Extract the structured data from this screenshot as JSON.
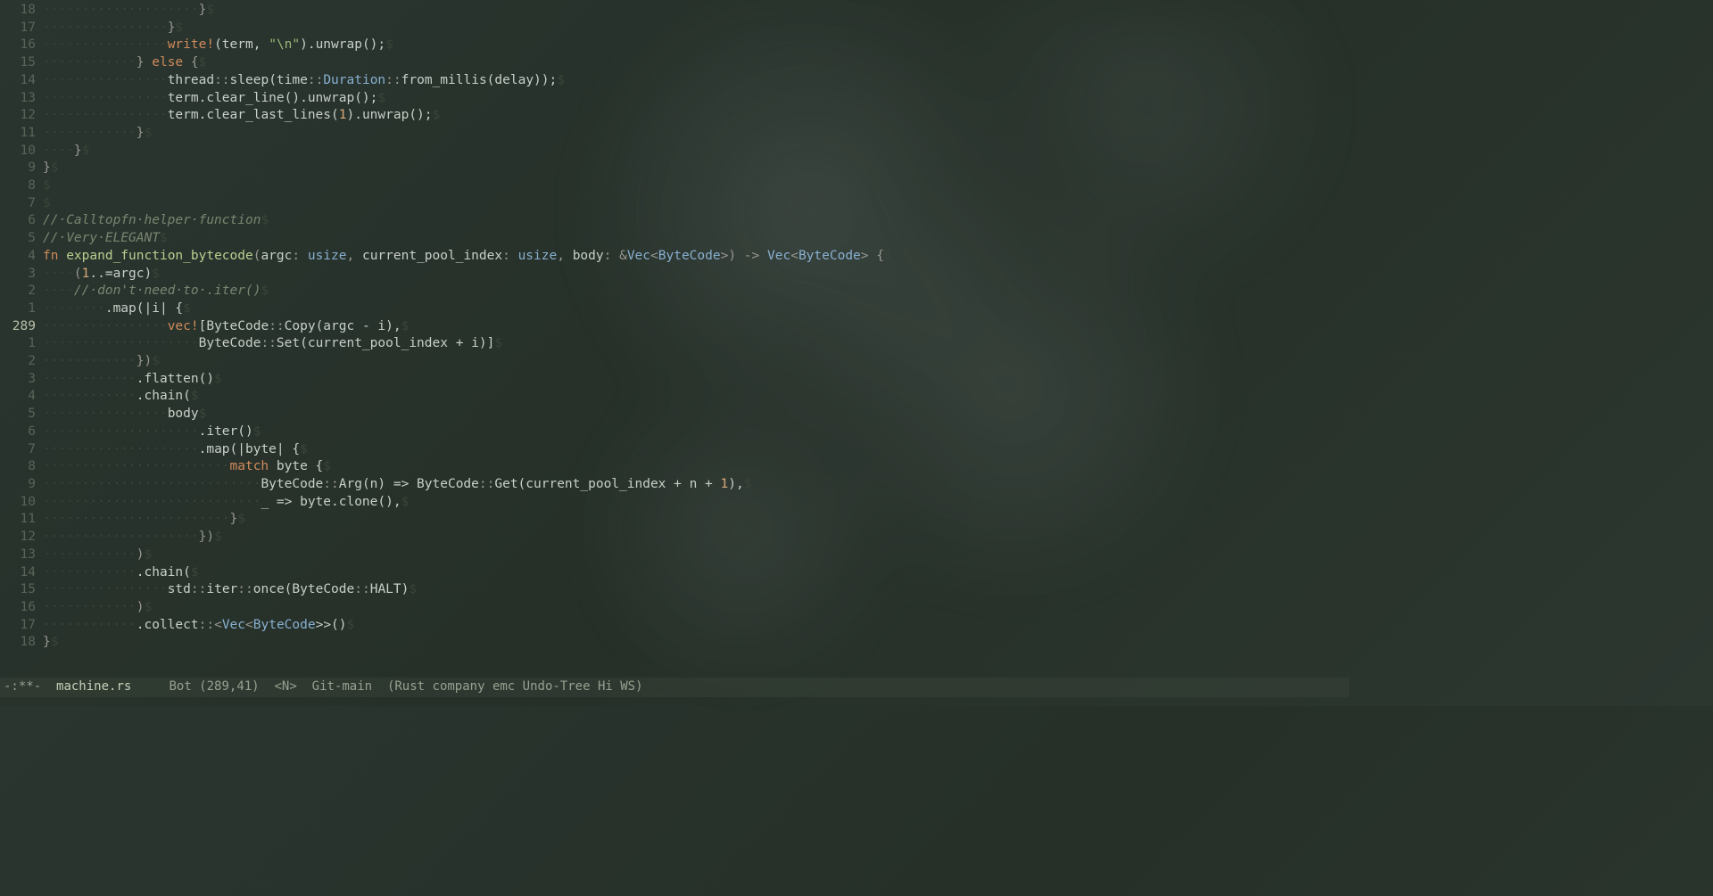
{
  "modeline": {
    "modified": "-:**-",
    "filename": "machine.rs",
    "position": "Bot (289,41)",
    "mode_indicator": "<N>",
    "vc": "Git-main",
    "modes": "(Rust company emc Undo-Tree Hi WS)"
  },
  "current_line": "289",
  "lines": [
    {
      "n": "18",
      "indent": 20,
      "tokens": [
        {
          "t": "}",
          "c": "punct"
        }
      ]
    },
    {
      "n": "17",
      "indent": 16,
      "tokens": [
        {
          "t": "}",
          "c": "punct"
        }
      ]
    },
    {
      "n": "16",
      "indent": 16,
      "tokens": [
        {
          "t": "write!",
          "c": "macro"
        },
        {
          "t": "(term, ",
          "c": "var"
        },
        {
          "t": "\"\\n\"",
          "c": "str"
        },
        {
          "t": ").unwrap();",
          "c": "var"
        }
      ]
    },
    {
      "n": "15",
      "indent": 12,
      "tokens": [
        {
          "t": "} ",
          "c": "punct"
        },
        {
          "t": "else",
          "c": "kw"
        },
        {
          "t": " {",
          "c": "punct"
        }
      ]
    },
    {
      "n": "14",
      "indent": 16,
      "tokens": [
        {
          "t": "thread",
          "c": "var"
        },
        {
          "t": "::",
          "c": "punct"
        },
        {
          "t": "sleep(time",
          "c": "var"
        },
        {
          "t": "::",
          "c": "punct"
        },
        {
          "t": "Duration",
          "c": "type"
        },
        {
          "t": "::",
          "c": "punct"
        },
        {
          "t": "from_millis(delay));",
          "c": "var"
        }
      ]
    },
    {
      "n": "13",
      "indent": 16,
      "tokens": [
        {
          "t": "term.clear_line().unwrap();",
          "c": "var"
        }
      ]
    },
    {
      "n": "12",
      "indent": 16,
      "tokens": [
        {
          "t": "term.clear_last_lines(",
          "c": "var"
        },
        {
          "t": "1",
          "c": "num"
        },
        {
          "t": ").unwrap();",
          "c": "var"
        }
      ]
    },
    {
      "n": "11",
      "indent": 12,
      "tokens": [
        {
          "t": "}",
          "c": "punct"
        }
      ]
    },
    {
      "n": "10",
      "indent": 4,
      "tokens": [
        {
          "t": "}",
          "c": "punct"
        }
      ]
    },
    {
      "n": "9",
      "indent": 0,
      "tokens": [
        {
          "t": "}",
          "c": "punct"
        }
      ]
    },
    {
      "n": "8",
      "indent": 0,
      "tokens": [
        {
          "t": "",
          "c": "var"
        }
      ]
    },
    {
      "n": "7",
      "indent": 0,
      "tokens": [
        {
          "t": "",
          "c": "var"
        }
      ]
    },
    {
      "n": "6",
      "indent": 0,
      "tokens": [
        {
          "t": "// Calltopfn helper function",
          "c": "comment"
        }
      ]
    },
    {
      "n": "5",
      "indent": 0,
      "tokens": [
        {
          "t": "// Very ELEGANT",
          "c": "comment"
        }
      ]
    },
    {
      "n": "4",
      "indent": 0,
      "tokens": [
        {
          "t": "fn ",
          "c": "kw"
        },
        {
          "t": "expand_function_bytecode",
          "c": "fn-name"
        },
        {
          "t": "(",
          "c": "punct"
        },
        {
          "t": "argc",
          "c": "var"
        },
        {
          "t": ": ",
          "c": "punct"
        },
        {
          "t": "usize",
          "c": "type"
        },
        {
          "t": ", ",
          "c": "punct"
        },
        {
          "t": "current_pool_index",
          "c": "var"
        },
        {
          "t": ": ",
          "c": "punct"
        },
        {
          "t": "usize",
          "c": "type"
        },
        {
          "t": ", ",
          "c": "punct"
        },
        {
          "t": "body",
          "c": "var"
        },
        {
          "t": ": &",
          "c": "punct"
        },
        {
          "t": "Vec",
          "c": "type"
        },
        {
          "t": "<",
          "c": "punct"
        },
        {
          "t": "ByteCode",
          "c": "type"
        },
        {
          "t": ">) -> ",
          "c": "punct"
        },
        {
          "t": "Vec",
          "c": "type"
        },
        {
          "t": "<",
          "c": "punct"
        },
        {
          "t": "ByteCode",
          "c": "type"
        },
        {
          "t": "> {",
          "c": "punct"
        }
      ]
    },
    {
      "n": "3",
      "indent": 4,
      "tokens": [
        {
          "t": "(",
          "c": "punct"
        },
        {
          "t": "1",
          "c": "num"
        },
        {
          "t": "..=argc)",
          "c": "var"
        }
      ]
    },
    {
      "n": "2",
      "indent": 4,
      "tokens": [
        {
          "t": "// don't need to .iter()",
          "c": "comment"
        }
      ]
    },
    {
      "n": "1",
      "indent": 8,
      "tokens": [
        {
          "t": ".map(|i| {",
          "c": "var"
        }
      ]
    },
    {
      "n": "289",
      "indent": 16,
      "tokens": [
        {
          "t": "vec!",
          "c": "macro"
        },
        {
          "t": "[ByteCode",
          "c": "var"
        },
        {
          "t": "::",
          "c": "punct"
        },
        {
          "t": "Copy(argc - i),",
          "c": "var"
        }
      ]
    },
    {
      "n": "1",
      "indent": 20,
      "tokens": [
        {
          "t": "ByteCode",
          "c": "var"
        },
        {
          "t": "::",
          "c": "punct"
        },
        {
          "t": "Set(current_pool_index + i)]",
          "c": "var"
        }
      ]
    },
    {
      "n": "2",
      "indent": 12,
      "tokens": [
        {
          "t": "})",
          "c": "punct"
        }
      ]
    },
    {
      "n": "3",
      "indent": 12,
      "tokens": [
        {
          "t": ".flatten()",
          "c": "var"
        }
      ]
    },
    {
      "n": "4",
      "indent": 12,
      "tokens": [
        {
          "t": ".chain(",
          "c": "var"
        }
      ]
    },
    {
      "n": "5",
      "indent": 16,
      "tokens": [
        {
          "t": "body",
          "c": "var"
        }
      ]
    },
    {
      "n": "6",
      "indent": 20,
      "tokens": [
        {
          "t": ".iter()",
          "c": "var"
        }
      ]
    },
    {
      "n": "7",
      "indent": 20,
      "tokens": [
        {
          "t": ".map(|byte| {",
          "c": "var"
        }
      ]
    },
    {
      "n": "8",
      "indent": 24,
      "tokens": [
        {
          "t": "match ",
          "c": "kw"
        },
        {
          "t": "byte {",
          "c": "var"
        }
      ]
    },
    {
      "n": "9",
      "indent": 28,
      "tokens": [
        {
          "t": "ByteCode",
          "c": "var"
        },
        {
          "t": "::",
          "c": "punct"
        },
        {
          "t": "Arg(n) => ByteCode",
          "c": "var"
        },
        {
          "t": "::",
          "c": "punct"
        },
        {
          "t": "Get(current_pool_index + n + ",
          "c": "var"
        },
        {
          "t": "1",
          "c": "num"
        },
        {
          "t": "),",
          "c": "var"
        }
      ]
    },
    {
      "n": "10",
      "indent": 28,
      "tokens": [
        {
          "t": "_ => byte.clone(),",
          "c": "var"
        }
      ]
    },
    {
      "n": "11",
      "indent": 24,
      "tokens": [
        {
          "t": "}",
          "c": "punct"
        }
      ]
    },
    {
      "n": "12",
      "indent": 20,
      "tokens": [
        {
          "t": "})",
          "c": "punct"
        }
      ]
    },
    {
      "n": "13",
      "indent": 12,
      "tokens": [
        {
          "t": ")",
          "c": "punct"
        }
      ]
    },
    {
      "n": "14",
      "indent": 12,
      "tokens": [
        {
          "t": ".chain(",
          "c": "var"
        }
      ]
    },
    {
      "n": "15",
      "indent": 16,
      "tokens": [
        {
          "t": "std",
          "c": "var"
        },
        {
          "t": "::",
          "c": "punct"
        },
        {
          "t": "iter",
          "c": "var"
        },
        {
          "t": "::",
          "c": "punct"
        },
        {
          "t": "once(ByteCode",
          "c": "var"
        },
        {
          "t": "::",
          "c": "punct"
        },
        {
          "t": "HALT)",
          "c": "var"
        }
      ]
    },
    {
      "n": "16",
      "indent": 12,
      "tokens": [
        {
          "t": ")",
          "c": "punct"
        }
      ]
    },
    {
      "n": "17",
      "indent": 12,
      "tokens": [
        {
          "t": ".collect",
          "c": "var"
        },
        {
          "t": "::",
          "c": "punct"
        },
        {
          "t": "<",
          "c": "punct"
        },
        {
          "t": "Vec",
          "c": "type"
        },
        {
          "t": "<",
          "c": "punct"
        },
        {
          "t": "ByteCode",
          "c": "type"
        },
        {
          "t": ">>()",
          "c": "var"
        }
      ]
    },
    {
      "n": "18",
      "indent": 0,
      "tokens": [
        {
          "t": "}",
          "c": "punct"
        }
      ]
    }
  ]
}
